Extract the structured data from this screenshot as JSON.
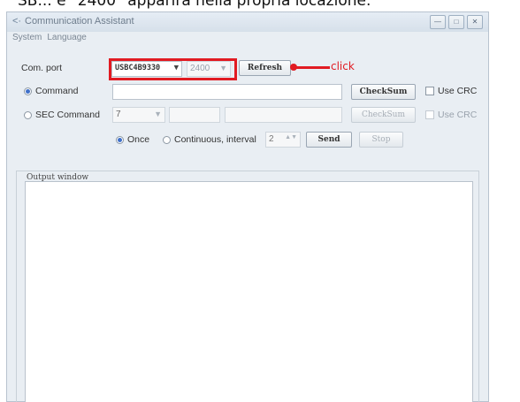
{
  "caption": "SB... e \"2400\" apparirà nella propria locazione.",
  "window": {
    "title": "Communication Assistant",
    "controls": [
      "minimize",
      "maximize",
      "close"
    ]
  },
  "menu": [
    "System",
    "Language"
  ],
  "port": {
    "label": "Com. port",
    "value": "USBC4B9330",
    "baud": "2400",
    "refresh_label": "Refresh"
  },
  "annotation": {
    "text": "click",
    "color": "#e11b22"
  },
  "command": {
    "label": "Command",
    "selected": true,
    "value": "",
    "checksum_label": "CheckSum",
    "crc_label": "Use CRC",
    "crc_checked": false
  },
  "sec_command": {
    "label": "SEC Command",
    "selected": false,
    "value": "7",
    "checksum_label": "CheckSum",
    "crc_label": "Use CRC",
    "crc_checked": false
  },
  "send_mode": {
    "once_label": "Once",
    "once_selected": true,
    "continuous_label": "Continuous, interval",
    "interval_value": "2",
    "send_label": "Send",
    "stop_label": "Stop"
  },
  "output": {
    "title": "Output window",
    "content": ""
  },
  "colors": {
    "accent": "#3f70c9",
    "highlight": "#e11b22",
    "window_bg": "#e9eef3"
  }
}
